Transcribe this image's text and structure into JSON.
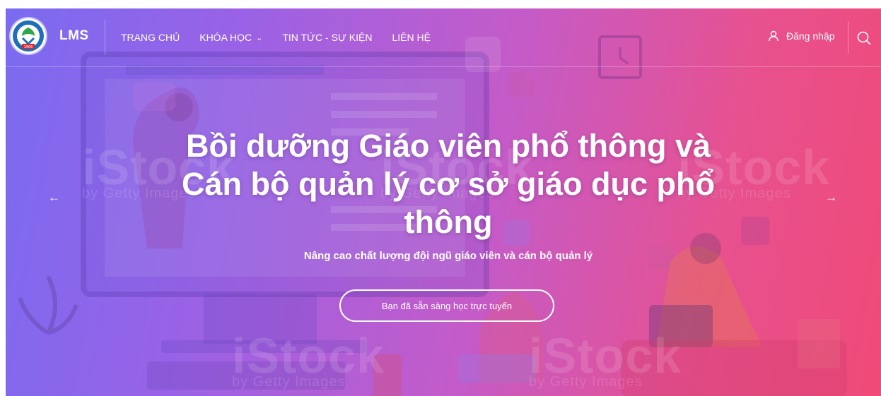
{
  "brand": {
    "name": "LMS",
    "logo_icon": "university-seal-icon",
    "logo_year": "1966"
  },
  "nav": {
    "items": [
      {
        "label": "TRANG CHỦ"
      },
      {
        "label": "KHÓA HỌC",
        "dropdown": true
      },
      {
        "label": "TIN TỨC - SỰ KIỆN"
      },
      {
        "label": "LIÊN HỆ"
      }
    ],
    "login_label": "Đăng nhập",
    "login_icon": "user-icon",
    "search_icon": "search-icon"
  },
  "hero": {
    "title": "Bồi dưỡng Giáo viên phổ thông và Cán bộ quản lý cơ sở giáo dục phổ thông",
    "subtitle": "Nâng cao chất lượng đội ngũ giáo viên và cán bộ quản lý",
    "cta_label": "Bạn đã sẵn sàng học trực tuyến",
    "prev_arrow": "←",
    "next_arrow": "→",
    "watermark_brand": "iStock",
    "watermark_tagline": "by Getty Images",
    "colors": {
      "gradient_start": "#7a6bf0",
      "gradient_mid": "#c45bc8",
      "gradient_end": "#f04a78"
    }
  }
}
